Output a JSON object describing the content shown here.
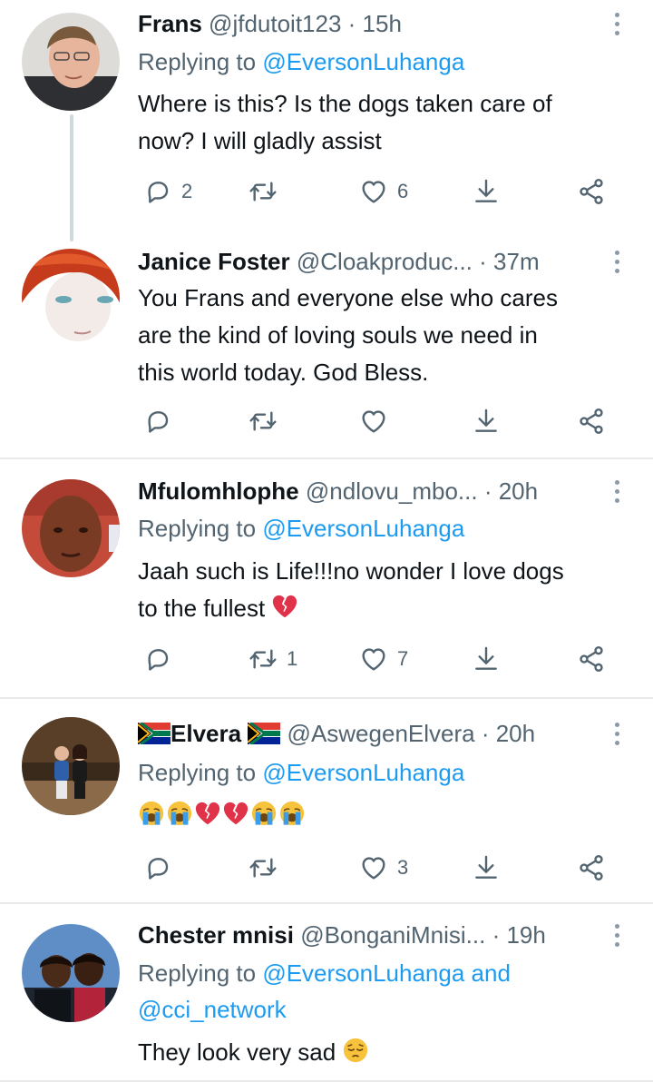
{
  "tweets": [
    {
      "name": "Frans",
      "handle": "@jfdutoit123",
      "time": "· 15h",
      "replying_label": "Replying to",
      "replying_to": "@EversonLuhanga",
      "body_lines": [
        "Where is this? Is the dogs taken care of",
        "now? I will gladly assist"
      ],
      "reply_count": "2",
      "retweet_count": "",
      "like_count": "6"
    },
    {
      "name": "Janice Foster",
      "handle": "@Cloakproduc...",
      "time": "· 37m",
      "body_lines": [
        "You Frans and everyone else who cares",
        "are the kind of loving souls we need in",
        "this world today.  God Bless."
      ],
      "reply_count": "",
      "retweet_count": "",
      "like_count": ""
    },
    {
      "name": "Mfulomhlophe",
      "handle": "@ndlovu_mbo...",
      "time": "· 20h",
      "replying_label": "Replying to",
      "replying_to": "@EversonLuhanga",
      "body_lines": [
        "Jaah such  is Life!!!no wonder I love dogs",
        "to the fullest"
      ],
      "reply_count": "",
      "retweet_count": "1",
      "like_count": "7"
    },
    {
      "name": "Elvera",
      "handle": "@AswegenElvera",
      "time": "· 20h",
      "replying_label": "Replying to",
      "replying_to": "@EversonLuhanga",
      "reply_count": "",
      "retweet_count": "",
      "like_count": "3"
    },
    {
      "name": "Chester mnisi",
      "handle": "@BonganiMnisi...",
      "time": "· 19h",
      "replying_label": "Replying to",
      "replying_to": "@EversonLuhanga",
      "replying_and": "and",
      "replying_to_2": "@cci_network",
      "body_lines": [
        "They look very sad"
      ]
    }
  ],
  "icons": {
    "reply": "speech-bubble-icon",
    "retweet": "retweet-arrows-icon",
    "like": "heart-outline-icon",
    "bookmark": "download-arrow-icon",
    "share": "share-nodes-icon",
    "more": "vertical-dots-icon",
    "emoji_broken_heart": "broken-heart-emoji",
    "emoji_crying": "loudly-crying-face-emoji",
    "emoji_pensive": "pensive-face-emoji",
    "flag": "south-africa-flag-emoji"
  },
  "colors": {
    "text": "#0f1419",
    "secondary": "#536471",
    "link": "#1d9bf0",
    "divider": "#e7e9ea",
    "thread_line": "#cfd9de"
  }
}
